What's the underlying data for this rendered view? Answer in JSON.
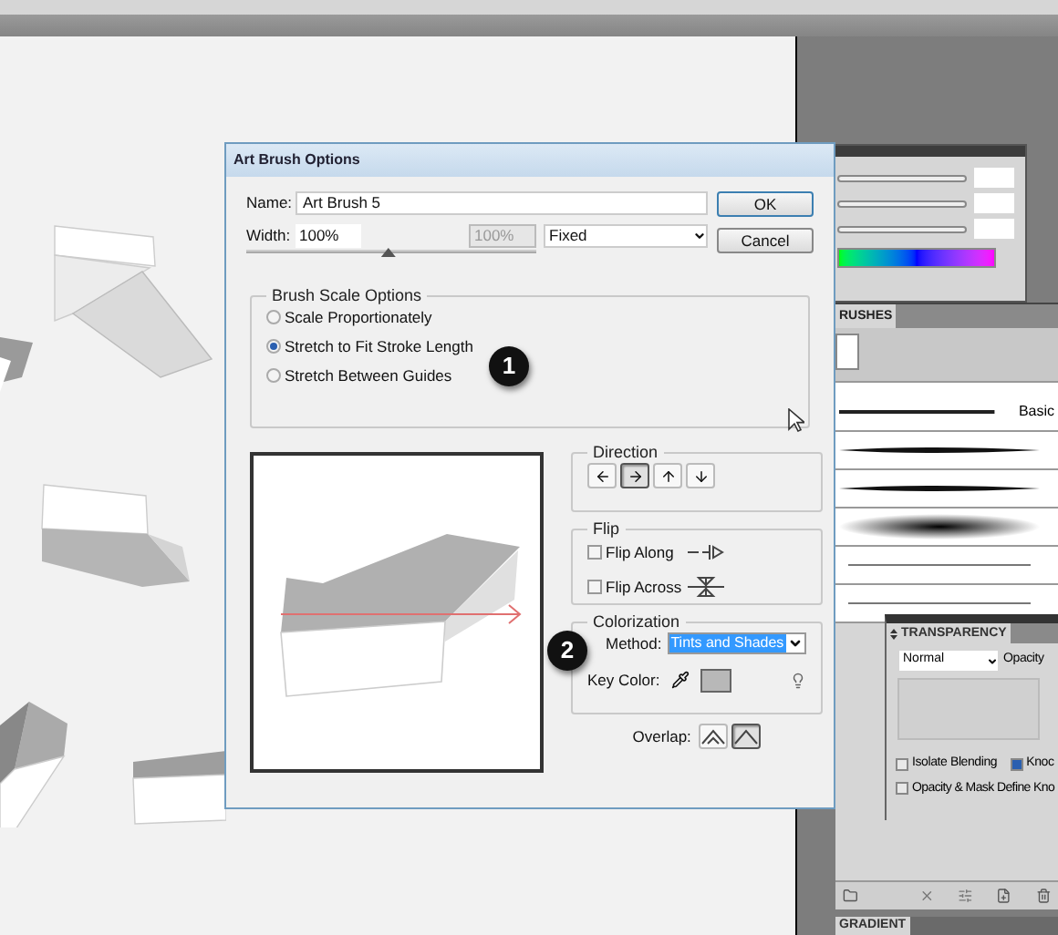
{
  "dialog": {
    "title": "Art Brush Options",
    "name_label": "Name:",
    "name_value": "Art Brush 5",
    "width_label": "Width:",
    "width_value": "100%",
    "width_limit": "100%",
    "width_slider": {
      "level": 0.49
    },
    "width_mode": "Fixed",
    "buttons": [
      "OK",
      "Cancel"
    ],
    "scale": {
      "title": "Brush Scale Options",
      "options": [
        {
          "label": "Scale Proportionately",
          "selected": false
        },
        {
          "label": "Stretch to Fit Stroke Length",
          "selected": true
        },
        {
          "label": "Stretch Between Guides",
          "selected": false
        }
      ]
    },
    "direction": {
      "title": "Direction",
      "options": [
        {
          "kind": "left",
          "selected": false
        },
        {
          "kind": "right",
          "selected": true
        },
        {
          "kind": "up",
          "selected": false
        },
        {
          "kind": "down",
          "selected": false
        }
      ]
    },
    "flip": {
      "title": "Flip",
      "options": [
        {
          "kind": "along",
          "label": "Flip Along",
          "checked": false
        },
        {
          "kind": "across",
          "label": "Flip Across",
          "checked": false
        }
      ]
    },
    "colorization": {
      "title": "Colorization",
      "method_label": "Method:",
      "method_value": "Tints and Shades",
      "key_color_label": "Key Color:"
    },
    "overlap": {
      "label": "Overlap:",
      "options": [
        {
          "kind": "adjust",
          "selected": false
        },
        {
          "kind": "none",
          "selected": true
        }
      ]
    }
  },
  "callouts": [
    "1",
    "2"
  ],
  "brushes_panel": {
    "tab": "RUSHES",
    "strokes": [
      {
        "kind": "line",
        "label": "Basic"
      },
      {
        "kind": "brush"
      },
      {
        "kind": "brush"
      },
      {
        "kind": "blob"
      },
      {
        "kind": "thin"
      },
      {
        "kind": "thin"
      }
    ]
  },
  "transparency_panel": {
    "tab": "TRANSPARENCY",
    "blend_mode": "Normal",
    "opacity_label": "Opacity",
    "options": [
      {
        "label": "Isolate Blending",
        "checked": false
      },
      {
        "label": "Knoc",
        "checked": true
      },
      {
        "label": "Opacity & Mask Define Kno",
        "checked": false
      }
    ]
  },
  "gradient_panel": {
    "tab": "GRADIENT"
  }
}
